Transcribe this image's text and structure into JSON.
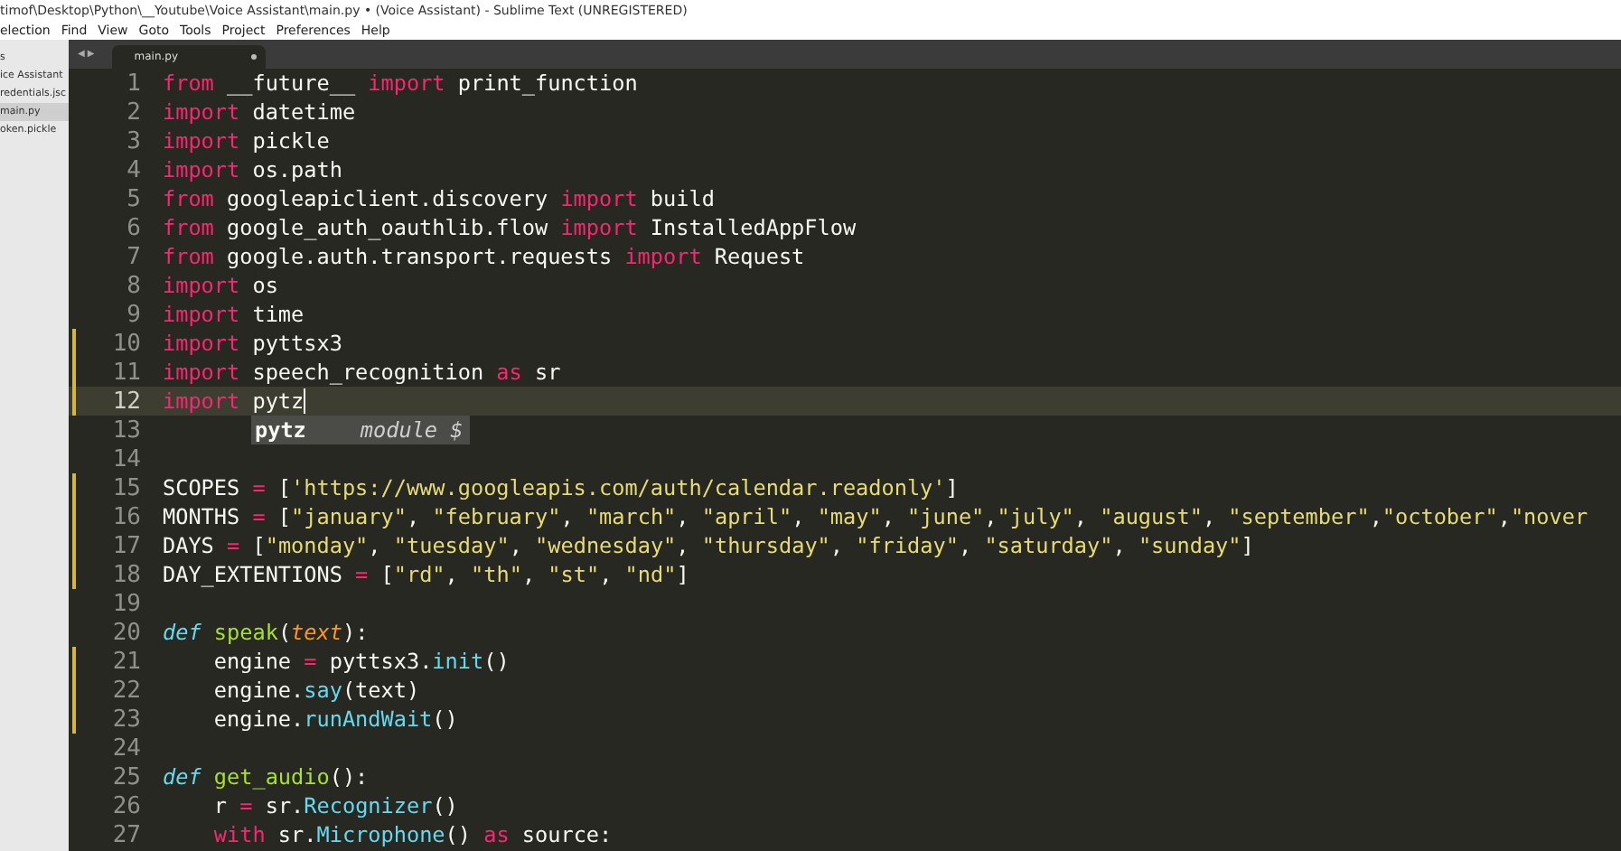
{
  "window": {
    "title": "timof\\Desktop\\Python\\__Youtube\\Voice Assistant\\main.py • (Voice Assistant) - Sublime Text (UNREGISTERED)"
  },
  "menu": [
    "election",
    "Find",
    "View",
    "Goto",
    "Tools",
    "Project",
    "Preferences",
    "Help"
  ],
  "sidebar": {
    "items": [
      {
        "label": "s",
        "selected": false
      },
      {
        "label": "ice Assistant",
        "selected": false
      },
      {
        "label": "redentials.jsc",
        "selected": false
      },
      {
        "label": "main.py",
        "selected": true
      },
      {
        "label": "oken.pickle",
        "selected": false
      }
    ]
  },
  "tab_nav": "◀ ▶",
  "tabs": [
    {
      "label": "main.py",
      "selected": true,
      "unsaved": true
    }
  ],
  "editor": {
    "lines": [
      {
        "number": "1",
        "current": false,
        "modified": false,
        "tokens": [
          {
            "kind": "kw",
            "text": "from"
          },
          {
            "kind": "plain",
            "text": " __future__ "
          },
          {
            "kind": "kw",
            "text": "import"
          },
          {
            "kind": "plain",
            "text": " print_function"
          }
        ]
      },
      {
        "number": "2",
        "current": false,
        "modified": false,
        "tokens": [
          {
            "kind": "kw",
            "text": "import"
          },
          {
            "kind": "plain",
            "text": " datetime"
          }
        ]
      },
      {
        "number": "3",
        "current": false,
        "modified": false,
        "tokens": [
          {
            "kind": "kw",
            "text": "import"
          },
          {
            "kind": "plain",
            "text": " pickle"
          }
        ]
      },
      {
        "number": "4",
        "current": false,
        "modified": false,
        "tokens": [
          {
            "kind": "kw",
            "text": "import"
          },
          {
            "kind": "plain",
            "text": " os.path"
          }
        ]
      },
      {
        "number": "5",
        "current": false,
        "modified": false,
        "tokens": [
          {
            "kind": "kw",
            "text": "from"
          },
          {
            "kind": "plain",
            "text": " googleapiclient.discovery "
          },
          {
            "kind": "kw",
            "text": "import"
          },
          {
            "kind": "plain",
            "text": " build"
          }
        ]
      },
      {
        "number": "6",
        "current": false,
        "modified": false,
        "tokens": [
          {
            "kind": "kw",
            "text": "from"
          },
          {
            "kind": "plain",
            "text": " google_auth_oauthlib.flow "
          },
          {
            "kind": "kw",
            "text": "import"
          },
          {
            "kind": "plain",
            "text": " InstalledAppFlow"
          }
        ]
      },
      {
        "number": "7",
        "current": false,
        "modified": false,
        "tokens": [
          {
            "kind": "kw",
            "text": "from"
          },
          {
            "kind": "plain",
            "text": " google.auth.transport.requests "
          },
          {
            "kind": "kw",
            "text": "import"
          },
          {
            "kind": "plain",
            "text": " Request"
          }
        ]
      },
      {
        "number": "8",
        "current": false,
        "modified": false,
        "tokens": [
          {
            "kind": "kw",
            "text": "import"
          },
          {
            "kind": "plain",
            "text": " os"
          }
        ]
      },
      {
        "number": "9",
        "current": false,
        "modified": false,
        "tokens": [
          {
            "kind": "kw",
            "text": "import"
          },
          {
            "kind": "plain",
            "text": " time"
          }
        ]
      },
      {
        "number": "10",
        "current": false,
        "modified": true,
        "tokens": [
          {
            "kind": "kw",
            "text": "import"
          },
          {
            "kind": "plain",
            "text": " pyttsx3"
          }
        ]
      },
      {
        "number": "11",
        "current": false,
        "modified": true,
        "tokens": [
          {
            "kind": "kw",
            "text": "import"
          },
          {
            "kind": "plain",
            "text": " speech_recognition "
          },
          {
            "kind": "kw",
            "text": "as"
          },
          {
            "kind": "plain",
            "text": " sr"
          }
        ]
      },
      {
        "number": "12",
        "current": true,
        "modified": true,
        "tokens": [
          {
            "kind": "kw",
            "text": "import"
          },
          {
            "kind": "plain",
            "text": " pytz"
          }
        ]
      },
      {
        "number": "13",
        "current": false,
        "modified": false
      },
      {
        "number": "14",
        "current": false,
        "modified": false
      },
      {
        "number": "15",
        "current": false,
        "modified": true,
        "tokens": [
          {
            "kind": "plain",
            "text": "SCOPES "
          },
          {
            "kind": "kw",
            "text": "="
          },
          {
            "kind": "plain",
            "text": " ["
          },
          {
            "kind": "str",
            "text": "'https://www.googleapis.com/auth/calendar.readonly'"
          },
          {
            "kind": "plain",
            "text": "]"
          }
        ]
      },
      {
        "number": "16",
        "current": false,
        "modified": true,
        "tokens": [
          {
            "kind": "plain",
            "text": "MONTHS "
          },
          {
            "kind": "kw",
            "text": "="
          },
          {
            "kind": "plain",
            "text": " ["
          },
          {
            "kind": "str",
            "text": "\"january\""
          },
          {
            "kind": "plain",
            "text": ", "
          },
          {
            "kind": "str",
            "text": "\"february\""
          },
          {
            "kind": "plain",
            "text": ", "
          },
          {
            "kind": "str",
            "text": "\"march\""
          },
          {
            "kind": "plain",
            "text": ", "
          },
          {
            "kind": "str",
            "text": "\"april\""
          },
          {
            "kind": "plain",
            "text": ", "
          },
          {
            "kind": "str",
            "text": "\"may\""
          },
          {
            "kind": "plain",
            "text": ", "
          },
          {
            "kind": "str",
            "text": "\"june\""
          },
          {
            "kind": "plain",
            "text": ","
          },
          {
            "kind": "str",
            "text": "\"july\""
          },
          {
            "kind": "plain",
            "text": ", "
          },
          {
            "kind": "str",
            "text": "\"august\""
          },
          {
            "kind": "plain",
            "text": ", "
          },
          {
            "kind": "str",
            "text": "\"september\""
          },
          {
            "kind": "plain",
            "text": ","
          },
          {
            "kind": "str",
            "text": "\"october\""
          },
          {
            "kind": "plain",
            "text": ","
          },
          {
            "kind": "str",
            "text": "\"nover"
          }
        ]
      },
      {
        "number": "17",
        "current": false,
        "modified": true,
        "tokens": [
          {
            "kind": "plain",
            "text": "DAYS "
          },
          {
            "kind": "kw",
            "text": "="
          },
          {
            "kind": "plain",
            "text": " ["
          },
          {
            "kind": "str",
            "text": "\"monday\""
          },
          {
            "kind": "plain",
            "text": ", "
          },
          {
            "kind": "str",
            "text": "\"tuesday\""
          },
          {
            "kind": "plain",
            "text": ", "
          },
          {
            "kind": "str",
            "text": "\"wednesday\""
          },
          {
            "kind": "plain",
            "text": ", "
          },
          {
            "kind": "str",
            "text": "\"thursday\""
          },
          {
            "kind": "plain",
            "text": ", "
          },
          {
            "kind": "str",
            "text": "\"friday\""
          },
          {
            "kind": "plain",
            "text": ", "
          },
          {
            "kind": "str",
            "text": "\"saturday\""
          },
          {
            "kind": "plain",
            "text": ", "
          },
          {
            "kind": "str",
            "text": "\"sunday\""
          },
          {
            "kind": "plain",
            "text": "]"
          }
        ]
      },
      {
        "number": "18",
        "current": false,
        "modified": true,
        "tokens": [
          {
            "kind": "plain",
            "text": "DAY_EXTENTIONS "
          },
          {
            "kind": "kw",
            "text": "="
          },
          {
            "kind": "plain",
            "text": " ["
          },
          {
            "kind": "str",
            "text": "\"rd\""
          },
          {
            "kind": "plain",
            "text": ", "
          },
          {
            "kind": "str",
            "text": "\"th\""
          },
          {
            "kind": "plain",
            "text": ", "
          },
          {
            "kind": "str",
            "text": "\"st\""
          },
          {
            "kind": "plain",
            "text": ", "
          },
          {
            "kind": "str",
            "text": "\"nd\""
          },
          {
            "kind": "plain",
            "text": "]"
          }
        ]
      },
      {
        "number": "19",
        "current": false,
        "modified": false
      },
      {
        "number": "20",
        "current": false,
        "modified": false,
        "tokens": [
          {
            "kind": "storage",
            "text": "def "
          },
          {
            "kind": "fn",
            "text": "speak"
          },
          {
            "kind": "plain",
            "text": "("
          },
          {
            "kind": "param",
            "text": "text"
          },
          {
            "kind": "plain",
            "text": "):"
          }
        ]
      },
      {
        "number": "21",
        "current": false,
        "modified": true,
        "tokens": [
          {
            "kind": "plain",
            "text": "    engine "
          },
          {
            "kind": "kw",
            "text": "="
          },
          {
            "kind": "plain",
            "text": " pyttsx3."
          },
          {
            "kind": "call",
            "text": "init"
          },
          {
            "kind": "plain",
            "text": "()"
          }
        ]
      },
      {
        "number": "22",
        "current": false,
        "modified": true,
        "tokens": [
          {
            "kind": "plain",
            "text": "    engine."
          },
          {
            "kind": "call",
            "text": "say"
          },
          {
            "kind": "plain",
            "text": "(text)"
          }
        ]
      },
      {
        "number": "23",
        "current": false,
        "modified": true,
        "tokens": [
          {
            "kind": "plain",
            "text": "    engine."
          },
          {
            "kind": "call",
            "text": "runAndWait"
          },
          {
            "kind": "plain",
            "text": "()"
          }
        ]
      },
      {
        "number": "24",
        "current": false,
        "modified": false
      },
      {
        "number": "25",
        "current": false,
        "modified": false,
        "tokens": [
          {
            "kind": "storage",
            "text": "def "
          },
          {
            "kind": "fn",
            "text": "get_audio"
          },
          {
            "kind": "plain",
            "text": "():"
          }
        ]
      },
      {
        "number": "26",
        "current": false,
        "modified": false,
        "tokens": [
          {
            "kind": "plain",
            "text": "    r "
          },
          {
            "kind": "kw",
            "text": "="
          },
          {
            "kind": "plain",
            "text": " sr."
          },
          {
            "kind": "call",
            "text": "Recognizer"
          },
          {
            "kind": "plain",
            "text": "()"
          }
        ]
      },
      {
        "number": "27",
        "current": false,
        "modified": false,
        "tokens": [
          {
            "kind": "kw",
            "text": "    with"
          },
          {
            "kind": "plain",
            "text": " sr."
          },
          {
            "kind": "call",
            "text": "Microphone"
          },
          {
            "kind": "plain",
            "text": "() "
          },
          {
            "kind": "kw",
            "text": "as"
          },
          {
            "kind": "plain",
            "text": " source:"
          }
        ]
      }
    ]
  },
  "autocomplete": {
    "items": [
      {
        "label": "pytz",
        "hint": "module $",
        "selected": true
      }
    ]
  }
}
